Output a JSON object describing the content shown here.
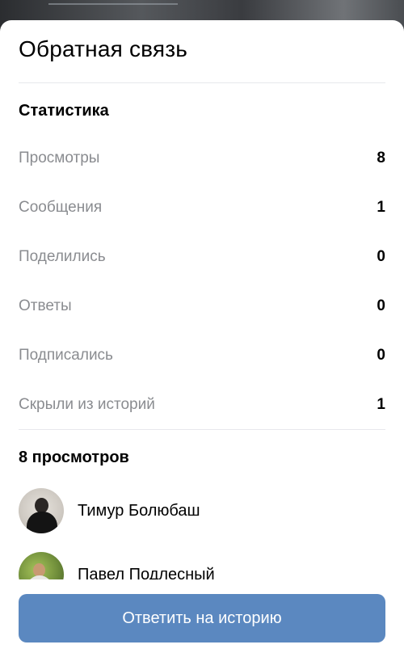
{
  "sheet": {
    "title": "Обратная связь"
  },
  "statistics": {
    "title": "Статистика",
    "rows": [
      {
        "label": "Просмотры",
        "value": "8"
      },
      {
        "label": "Сообщения",
        "value": "1"
      },
      {
        "label": "Поделились",
        "value": "0"
      },
      {
        "label": "Ответы",
        "value": "0"
      },
      {
        "label": "Подписались",
        "value": "0"
      },
      {
        "label": "Скрыли из историй",
        "value": "1"
      }
    ]
  },
  "viewers": {
    "title": "8 просмотров",
    "items": [
      {
        "name": "Тимур Болюбаш"
      },
      {
        "name": "Павел Подлесный"
      }
    ]
  },
  "actions": {
    "reply_label": "Ответить на историю",
    "reply_color": "#5b88c0"
  }
}
